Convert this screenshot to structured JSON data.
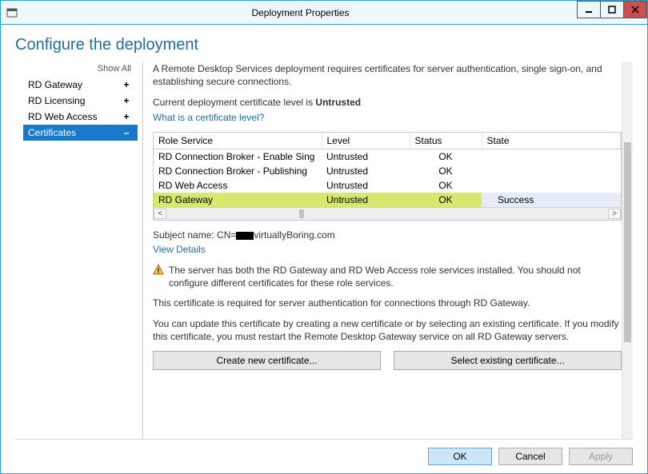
{
  "window": {
    "title": "Deployment Properties"
  },
  "page": {
    "heading": "Configure the deployment"
  },
  "sidebar": {
    "show_all": "Show All",
    "items": [
      {
        "label": "RD Gateway",
        "expander": "+",
        "selected": false
      },
      {
        "label": "RD Licensing",
        "expander": "+",
        "selected": false
      },
      {
        "label": "RD Web Access",
        "expander": "+",
        "selected": false
      },
      {
        "label": "Certificates",
        "expander": "–",
        "selected": true
      }
    ]
  },
  "main": {
    "intro": "A Remote Desktop Services deployment requires certificates for server authentication, single sign-on, and establishing secure connections.",
    "level_prefix": "Current deployment certificate level is ",
    "level_value": "Untrusted",
    "level_link": "What is a certificate level?",
    "table": {
      "columns": [
        "Role Service",
        "Level",
        "Status",
        "State"
      ],
      "rows": [
        {
          "role": "RD Connection Broker - Enable Sing",
          "level": "Untrusted",
          "status": "OK",
          "state": "",
          "highlight": false
        },
        {
          "role": "RD Connection Broker - Publishing",
          "level": "Untrusted",
          "status": "OK",
          "state": "",
          "highlight": false
        },
        {
          "role": "RD Web Access",
          "level": "Untrusted",
          "status": "OK",
          "state": "",
          "highlight": false
        },
        {
          "role": "RD Gateway",
          "level": "Untrusted",
          "status": "OK",
          "state": "Success",
          "highlight": true
        }
      ]
    },
    "subject_prefix": "Subject name: CN=",
    "subject_suffix": "virtuallyBoring.com",
    "view_details": "View Details",
    "warning": "The server has both the RD Gateway and RD Web Access role services installed. You should not configure different certificates for these role services.",
    "required_line": "This certificate is required for server authentication for connections through RD Gateway.",
    "update_line": "You can update this certificate by creating a new certificate or by selecting an existing certificate. If you modify this certificate, you must restart the Remote Desktop Gateway service on all RD Gateway servers.",
    "create_btn": "Create new certificate...",
    "select_btn": "Select existing certificate..."
  },
  "footer": {
    "ok": "OK",
    "cancel": "Cancel",
    "apply": "Apply"
  }
}
